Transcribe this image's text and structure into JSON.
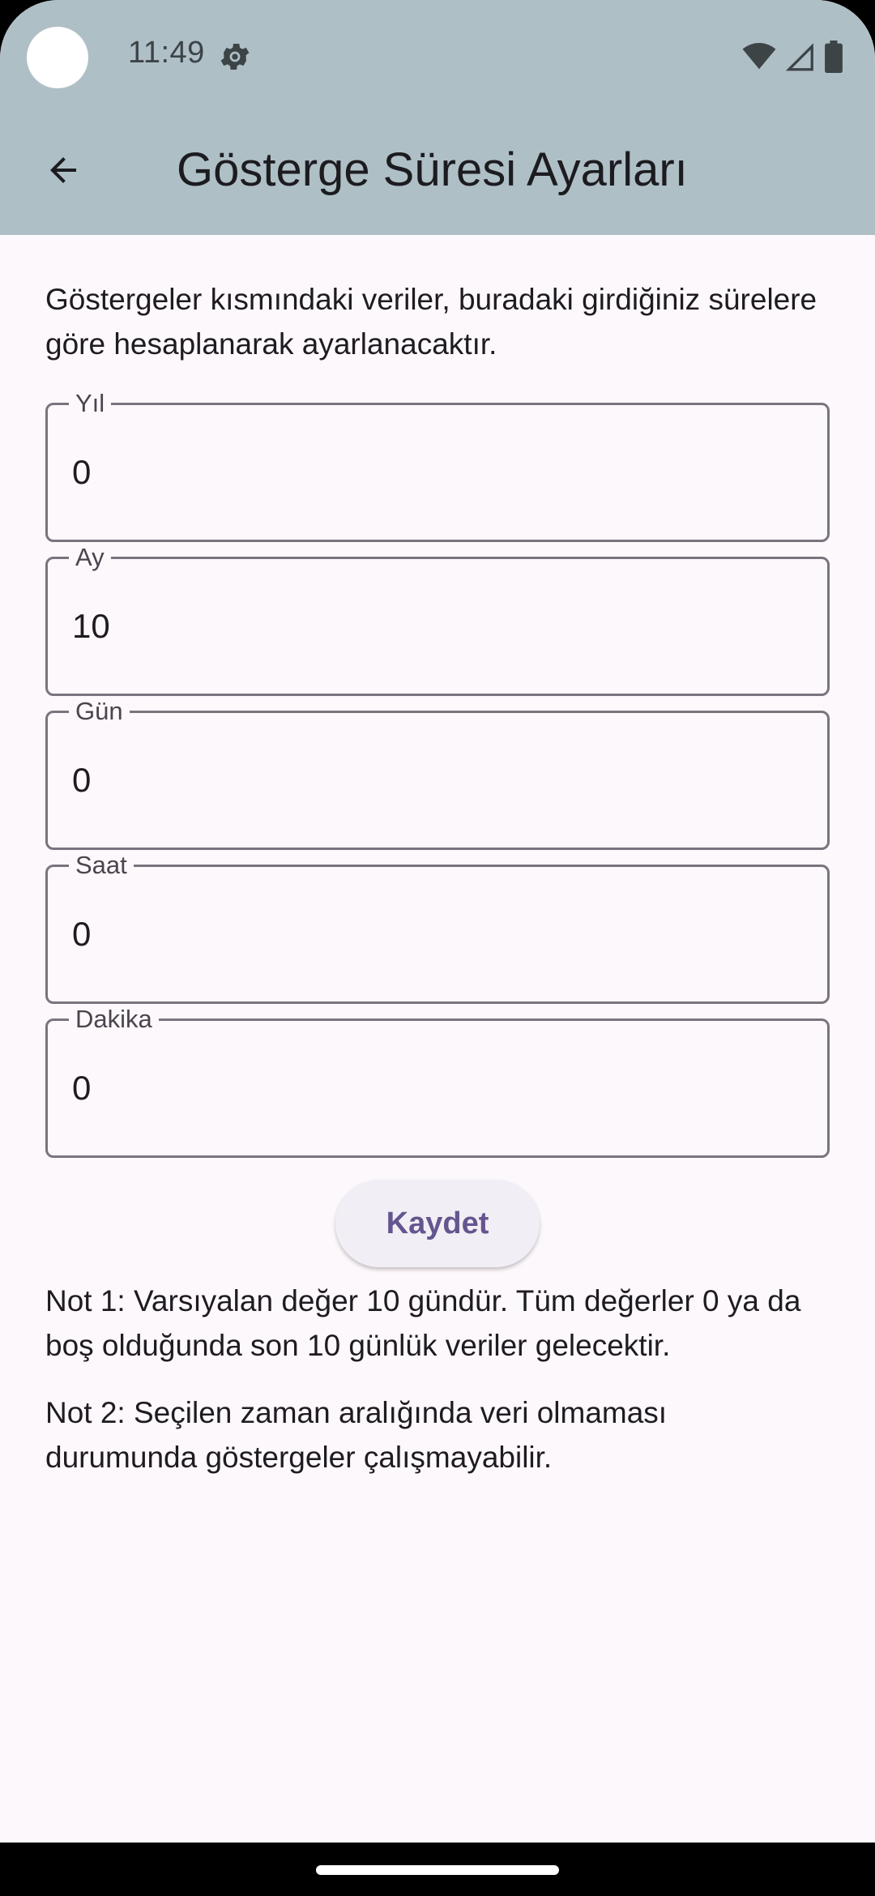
{
  "status_bar": {
    "time": "11:49",
    "icons": [
      "settings-gear-icon",
      "wifi-icon",
      "cell-signal-icon",
      "battery-icon"
    ]
  },
  "app_bar": {
    "back_icon": "arrow-back-icon",
    "title": "Gösterge Süresi Ayarları"
  },
  "intro_text": "Göstergeler kısmındaki veriler, buradaki girdiğiniz sürelere göre hesaplanarak ayarlanacaktır.",
  "fields": [
    {
      "label": "Yıl",
      "value": "0"
    },
    {
      "label": "Ay",
      "value": "10"
    },
    {
      "label": "Gün",
      "value": "0"
    },
    {
      "label": "Saat",
      "value": "0"
    },
    {
      "label": "Dakika",
      "value": "0"
    }
  ],
  "save_button": "Kaydet",
  "notes": [
    "Not 1: Varsıyalan değer 10 gündür. Tüm değerler 0 ya da boş olduğunda son 10 günlük veriler gelecektir.",
    "Not 2: Seçilen zaman aralığında veri olmaması durumunda göstergeler çalışmayabilir."
  ],
  "colors": {
    "app_bar": "#afbfc6",
    "background": "#fdf8fb",
    "field_border": "#79747e",
    "button_text": "#65558f",
    "button_bg": "#f2eef5"
  }
}
